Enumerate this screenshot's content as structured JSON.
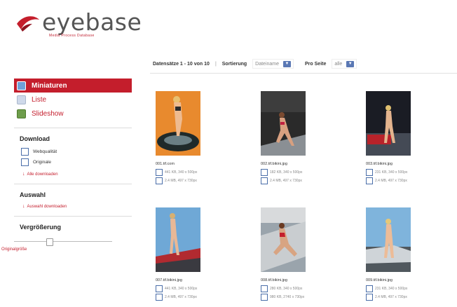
{
  "brand": {
    "name": "eyebase",
    "tagline": "Media Process Database",
    "accent": "#c41e2c"
  },
  "toolbar": {
    "count": "Datensätze 1 - 10 von 10",
    "sort_label": "Sortierung",
    "sort_value": "Dateiname",
    "per_page_label": "Pro Seite",
    "per_page_value": "alle"
  },
  "sidebar": {
    "views": [
      {
        "label": "Miniaturen",
        "icon": "thumbnails-icon",
        "active": true
      },
      {
        "label": "Liste",
        "icon": "list-icon",
        "active": false
      },
      {
        "label": "Slideshow",
        "icon": "slideshow-icon",
        "active": false
      }
    ],
    "download": {
      "title": "Download",
      "options": [
        "Webqualität",
        "Originale"
      ],
      "link": "Alle downloaden"
    },
    "selection": {
      "title": "Auswahl",
      "link": "Auswahl downloaden"
    },
    "zoom": {
      "title": "Vergrößerung",
      "original_size": "Originalgröße",
      "level": 0.36
    }
  },
  "images": [
    {
      "caption": "001.tif.com",
      "opts": [
        "441 KB, 340 x 500px",
        "2.4 MB, 497 x 730px"
      ]
    },
    {
      "caption": "002.tif.bikini.jpg",
      "opts": [
        "182 KB, 340 x 500px",
        "2.4 MB, 497 x 730px"
      ]
    },
    {
      "caption": "003.tif.bikini.jpg",
      "opts": [
        "231 KB, 340 x 500px",
        "2.4 MB, 497 x 730px"
      ]
    },
    {
      "caption": "007.tif.bikini.jpg",
      "opts": [
        "441 KB, 340 x 500px",
        "2.4 MB, 497 x 730px"
      ]
    },
    {
      "caption": "008.tif.bikini.jpg",
      "opts": [
        "280 KB, 340 x 500px",
        "980 KB, 2740 x 730px"
      ]
    },
    {
      "caption": "009.tif.bikini.jpg",
      "opts": [
        "231 KB, 340 x 500px",
        "2.4 MB, 497 x 730px"
      ]
    }
  ]
}
